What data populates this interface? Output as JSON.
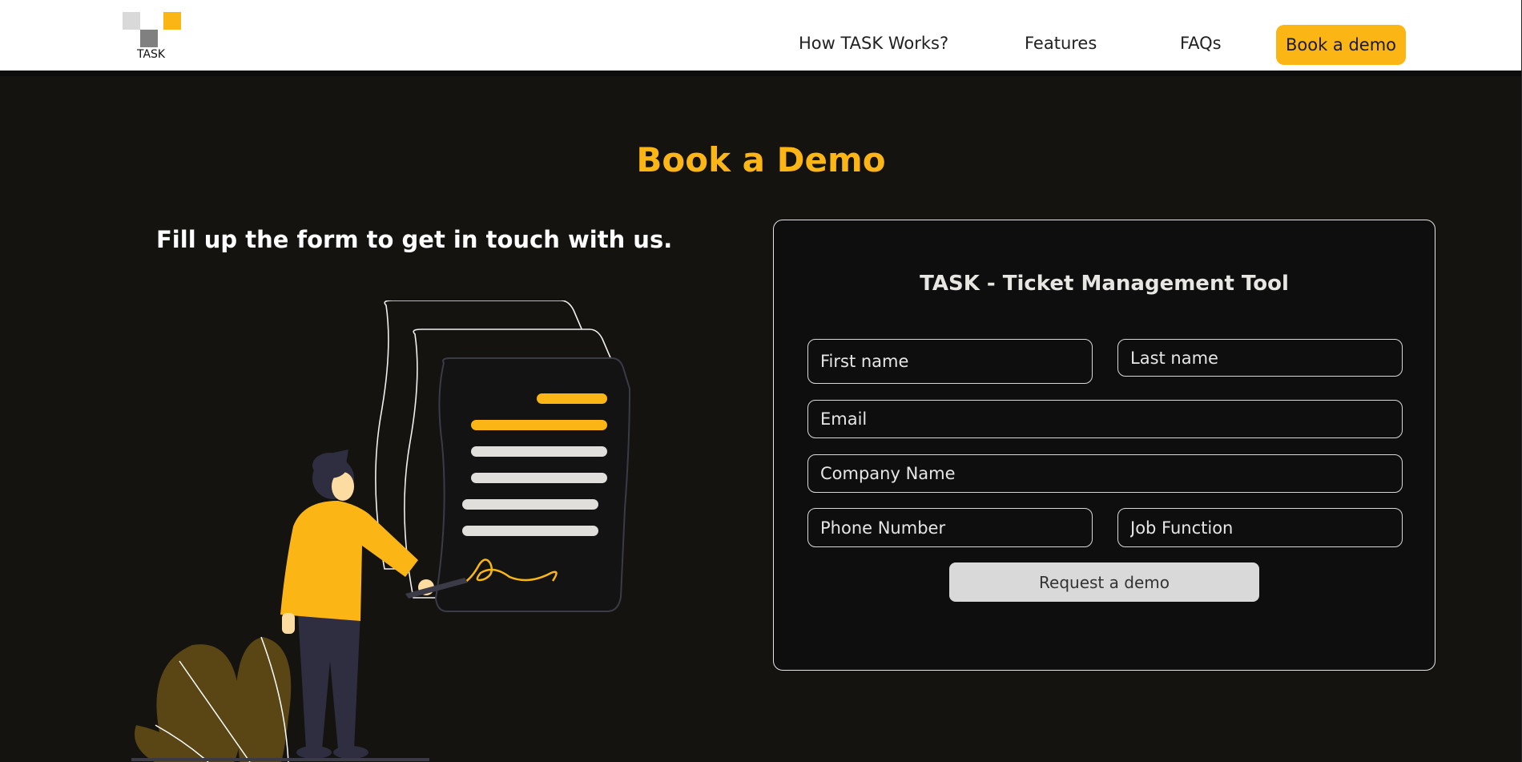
{
  "brand": {
    "name": "TASK",
    "accent_color": "#fbb615"
  },
  "nav": {
    "items": [
      {
        "label": "How TASK Works?"
      },
      {
        "label": "Features"
      },
      {
        "label": "FAQs"
      }
    ],
    "cta_label": "Book a demo"
  },
  "hero": {
    "title": "Book a Demo",
    "subtitle": "Fill up the form to get in touch with us."
  },
  "form": {
    "title": "TASK - Ticket Management Tool",
    "fields": {
      "first_name": {
        "placeholder": "First name",
        "value": ""
      },
      "last_name": {
        "placeholder": "Last name",
        "value": ""
      },
      "email": {
        "placeholder": "Email",
        "value": ""
      },
      "company": {
        "placeholder": "Company Name",
        "value": ""
      },
      "phone": {
        "placeholder": "Phone Number",
        "value": ""
      },
      "job_function": {
        "placeholder": "Job Function",
        "value": ""
      }
    },
    "submit_label": "Request a demo"
  },
  "illustration": {
    "icon": "person-signing-document-illustration"
  }
}
